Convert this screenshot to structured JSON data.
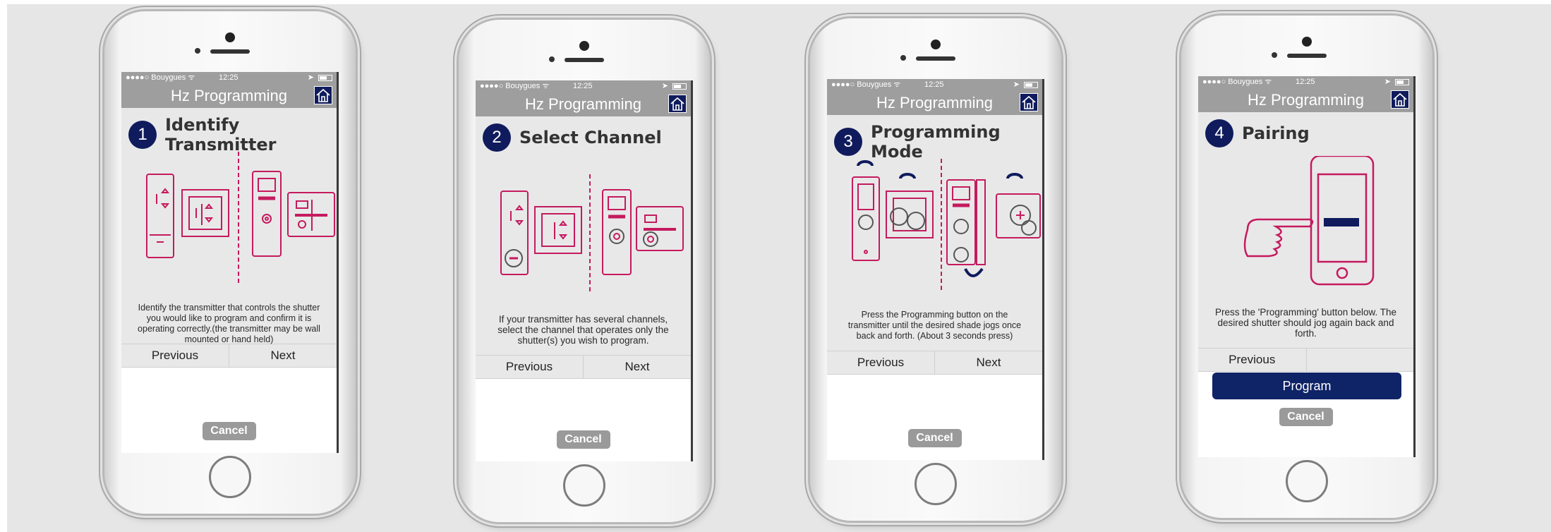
{
  "colors": {
    "brand_navy": "#0f1b5c",
    "accent_magenta": "#c51a5e",
    "bar_gray": "#9e9e9e"
  },
  "status": {
    "carrier": "●●●●○ Bouygues ᯤ",
    "time": "12:25",
    "location_symbol": "➤"
  },
  "phones": [
    {
      "title": "Hz Programming",
      "step_number": "1",
      "step_title": "Identify Transmitter",
      "description": "Identify the transmitter that controls the shutter you would like to program and confirm it is operating correctly.(the transmitter may be wall mounted or hand held)",
      "previous_label": "Previous",
      "next_label": "Next",
      "cancel_label": "Cancel"
    },
    {
      "title": "Hz Programming",
      "step_number": "2",
      "step_title": "Select Channel",
      "description": "If your transmitter has several channels, select the channel that operates only the shutter(s) you wish to program.",
      "previous_label": "Previous",
      "next_label": "Next",
      "cancel_label": "Cancel"
    },
    {
      "title": "Hz Programming",
      "step_number": "3",
      "step_title": "Programming Mode",
      "description": "Press the Programming button on the transmitter until the desired shade jogs once back and forth. (About 3 seconds press)",
      "previous_label": "Previous",
      "next_label": "Next",
      "cancel_label": "Cancel"
    },
    {
      "title": "Hz Programming",
      "step_number": "4",
      "step_title": "Pairing",
      "description": "Press the 'Programming' button below. The desired shutter should jog again back and forth.",
      "previous_label": "Previous",
      "program_label": "Program",
      "cancel_label": "Cancel"
    }
  ]
}
